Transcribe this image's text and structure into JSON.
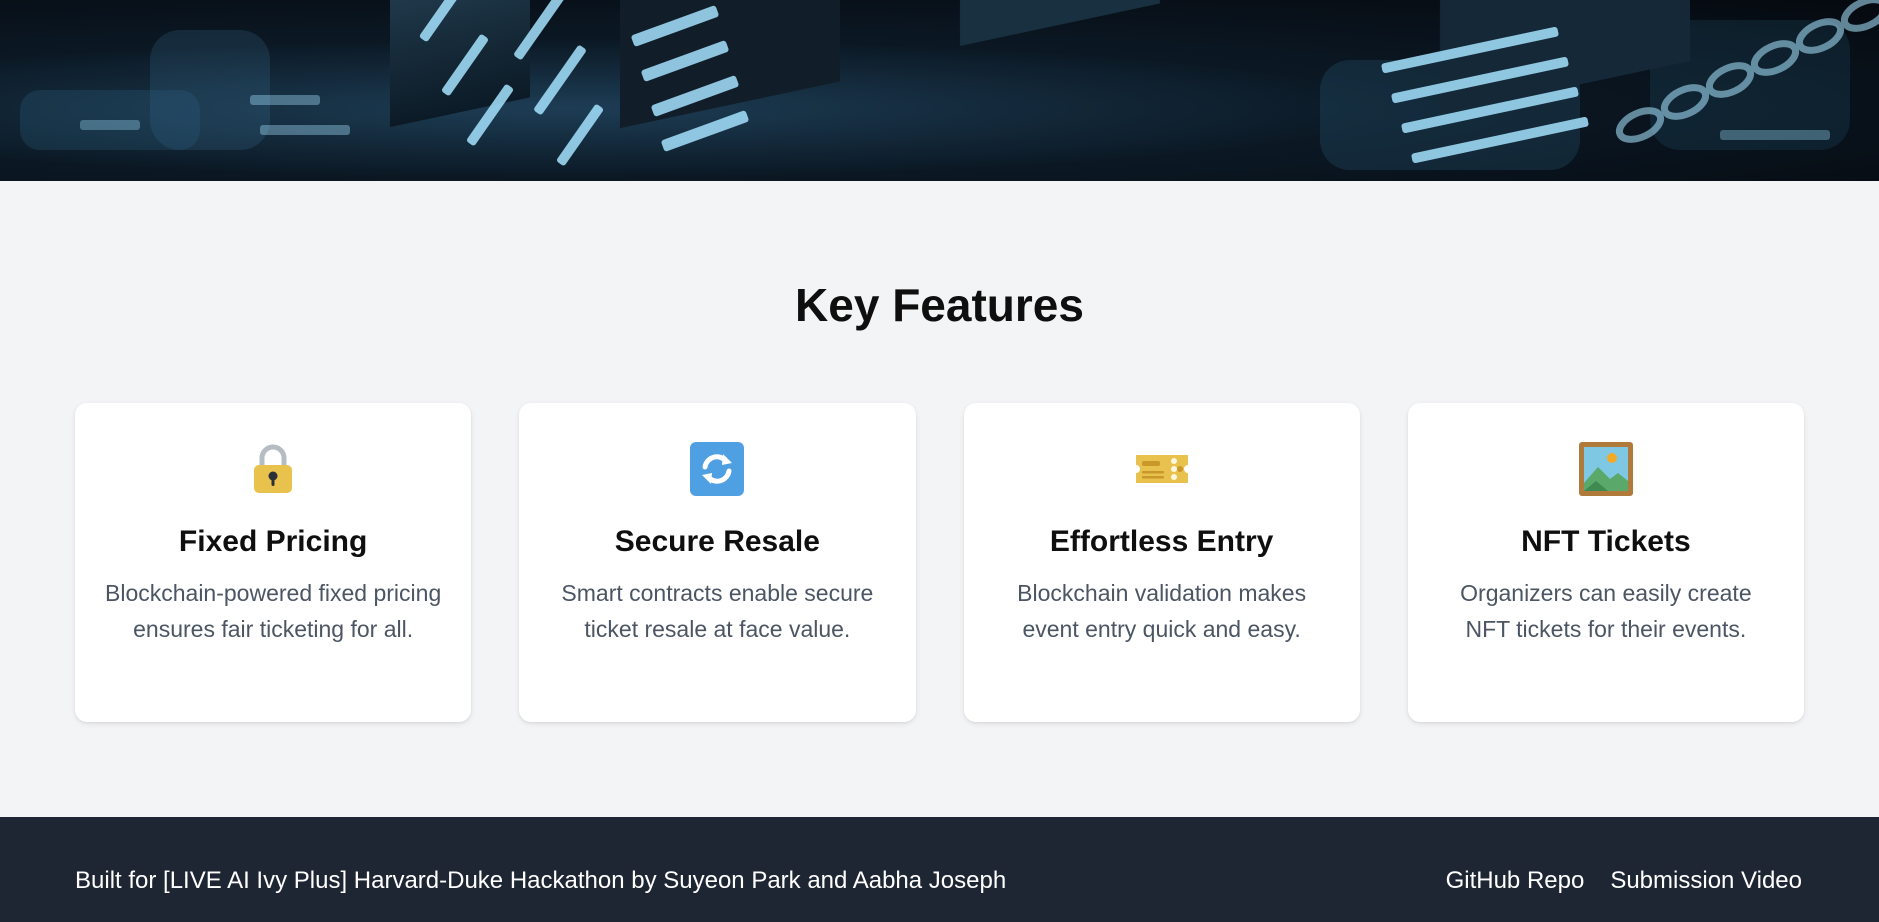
{
  "features": {
    "title": "Key Features",
    "cards": [
      {
        "icon": "lock-icon",
        "title": "Fixed Pricing",
        "description": "Blockchain-powered fixed pricing ensures fair ticketing for all."
      },
      {
        "icon": "refresh-icon",
        "title": "Secure Resale",
        "description": "Smart contracts enable secure ticket resale at face value."
      },
      {
        "icon": "ticket-icon",
        "title": "Effortless Entry",
        "description": "Blockchain validation makes event entry quick and easy."
      },
      {
        "icon": "framed-picture-icon",
        "title": "NFT Tickets",
        "description": "Organizers can easily create NFT tickets for their events."
      }
    ]
  },
  "footer": {
    "credit": "Built for [LIVE AI Ivy Plus] Harvard-Duke Hackathon by Suyeon Park and Aabha Joseph",
    "links": [
      "GitHub Repo",
      "Submission Video"
    ]
  },
  "colors": {
    "background": "#f3f4f6",
    "card": "#ffffff",
    "footer": "#1f2633",
    "text_muted": "#4b5563"
  }
}
